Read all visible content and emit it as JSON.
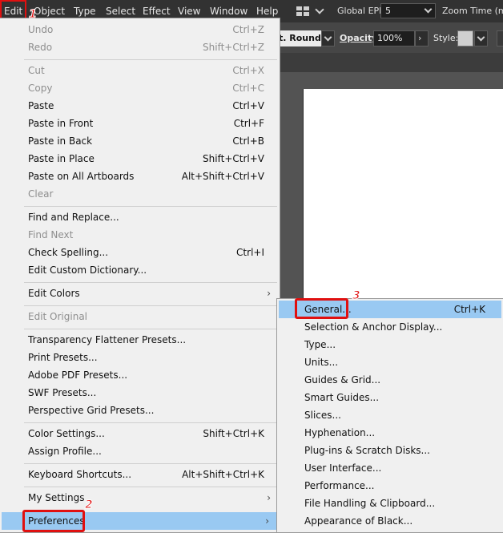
{
  "menubar": {
    "items": [
      "Edit",
      "Object",
      "Type",
      "Select",
      "Effect",
      "View",
      "Window",
      "Help"
    ],
    "global_epf_label": "Global EPF:",
    "global_epf_value": "5",
    "zoom_label": "Zoom Time (ms):"
  },
  "control_bar": {
    "cap_value": "t. Round",
    "opacity_label": "Opacity:",
    "opacity_value": "100%",
    "style_label": "Style:"
  },
  "edit_menu": {
    "undo": {
      "label": "Undo",
      "shortcut": "Ctrl+Z"
    },
    "redo": {
      "label": "Redo",
      "shortcut": "Shift+Ctrl+Z"
    },
    "cut": {
      "label": "Cut",
      "shortcut": "Ctrl+X"
    },
    "copy": {
      "label": "Copy",
      "shortcut": "Ctrl+C"
    },
    "paste": {
      "label": "Paste",
      "shortcut": "Ctrl+V"
    },
    "paste_front": {
      "label": "Paste in Front",
      "shortcut": "Ctrl+F"
    },
    "paste_back": {
      "label": "Paste in Back",
      "shortcut": "Ctrl+B"
    },
    "paste_place": {
      "label": "Paste in Place",
      "shortcut": "Shift+Ctrl+V"
    },
    "paste_all": {
      "label": "Paste on All Artboards",
      "shortcut": "Alt+Shift+Ctrl+V"
    },
    "clear": {
      "label": "Clear"
    },
    "find_replace": {
      "label": "Find and Replace..."
    },
    "find_next": {
      "label": "Find Next"
    },
    "check_spelling": {
      "label": "Check Spelling...",
      "shortcut": "Ctrl+I"
    },
    "custom_dict": {
      "label": "Edit Custom Dictionary..."
    },
    "edit_colors": {
      "label": "Edit Colors"
    },
    "edit_original": {
      "label": "Edit Original"
    },
    "transparency_presets": {
      "label": "Transparency Flattener Presets..."
    },
    "print_presets": {
      "label": "Print Presets..."
    },
    "pdf_presets": {
      "label": "Adobe PDF Presets..."
    },
    "swf_presets": {
      "label": "SWF Presets..."
    },
    "perspective_presets": {
      "label": "Perspective Grid Presets..."
    },
    "color_settings": {
      "label": "Color Settings...",
      "shortcut": "Shift+Ctrl+K"
    },
    "assign_profile": {
      "label": "Assign Profile..."
    },
    "keyboard_shortcuts": {
      "label": "Keyboard Shortcuts...",
      "shortcut": "Alt+Shift+Ctrl+K"
    },
    "my_settings": {
      "label": "My Settings"
    },
    "preferences": {
      "label": "Preferences"
    }
  },
  "pref_submenu": {
    "general": {
      "label": "General...",
      "shortcut": "Ctrl+K"
    },
    "selection": {
      "label": "Selection & Anchor Display..."
    },
    "type": {
      "label": "Type..."
    },
    "units": {
      "label": "Units..."
    },
    "guides": {
      "label": "Guides & Grid..."
    },
    "smart_guides": {
      "label": "Smart Guides..."
    },
    "slices": {
      "label": "Slices..."
    },
    "hyphenation": {
      "label": "Hyphenation..."
    },
    "plugins": {
      "label": "Plug-ins & Scratch Disks..."
    },
    "ui": {
      "label": "User Interface..."
    },
    "performance": {
      "label": "Performance..."
    },
    "file_handling": {
      "label": "File Handling & Clipboard..."
    },
    "black": {
      "label": "Appearance of Black..."
    }
  },
  "badges": {
    "step1": "1",
    "step2": "2",
    "step3": "3"
  },
  "colors": {
    "highlight": "#99c9f2",
    "annotation_red": "#e01010"
  }
}
